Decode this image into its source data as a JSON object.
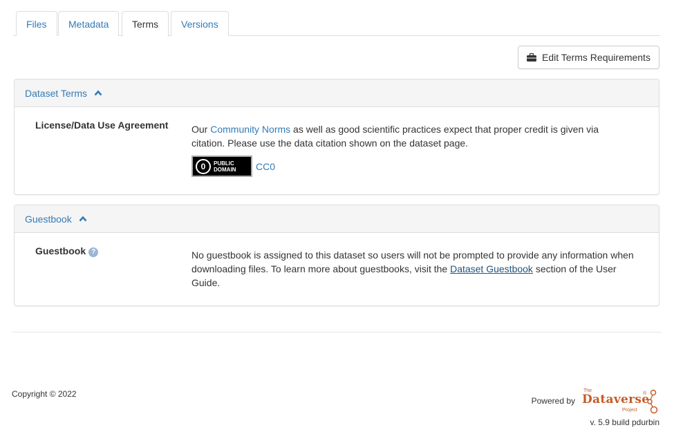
{
  "tabs": [
    {
      "label": "Files"
    },
    {
      "label": "Metadata"
    },
    {
      "label": "Terms"
    },
    {
      "label": "Versions"
    }
  ],
  "edit_button": {
    "label": "Edit Terms Requirements",
    "icon": "briefcase-icon"
  },
  "dataset_terms": {
    "title": "Dataset Terms",
    "license_label": "License/Data Use Agreement",
    "text_prefix": "Our ",
    "community_norms_link": "Community Norms",
    "text_suffix": " as well as good scientific practices expect that proper credit is given via citation. Please use the data citation shown on the dataset page.",
    "badge_line1": "PUBLIC",
    "badge_line2": "DOMAIN",
    "badge_symbol": "0",
    "license_link": "CC0"
  },
  "guestbook": {
    "title": "Guestbook",
    "label": "Guestbook",
    "help_icon": "?",
    "text_prefix": "No guestbook is assigned to this dataset so users will not be prompted to provide any information when downloading files. To learn more about guestbooks, visit the ",
    "guide_link": "Dataset Guestbook",
    "text_suffix": " section of the User Guide."
  },
  "footer": {
    "copyright": "Copyright © 2022",
    "powered_by": "Powered by",
    "logo_the": "The",
    "logo_name": "Dataverse",
    "logo_reg": "®",
    "logo_project": "Project",
    "version": "v. 5.9 build pdurbin"
  },
  "colors": {
    "link": "#337ab7",
    "brand": "#c55b28"
  }
}
